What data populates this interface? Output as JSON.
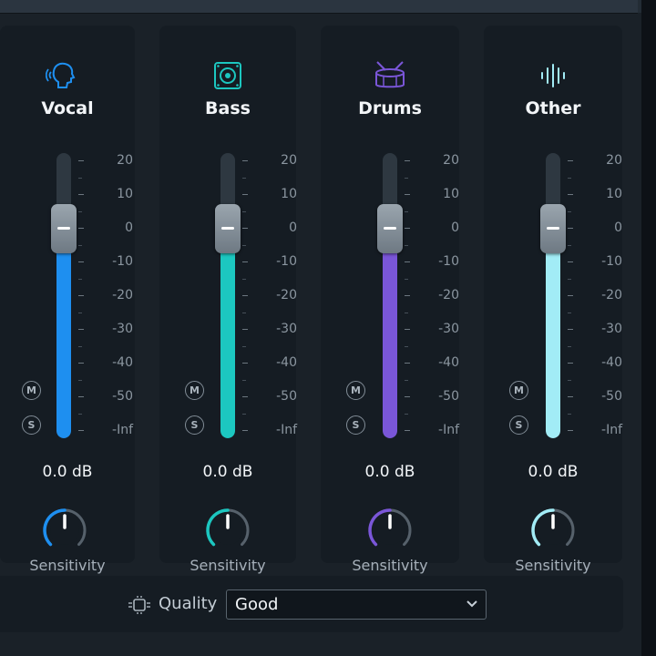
{
  "strips": [
    {
      "name": "Vocal",
      "icon": "vocal-head-icon",
      "color": "#1e8ff0",
      "db": "0.0 dB",
      "level_db": 0,
      "sensitivity_label": "Sensitivity",
      "sensitivity_fraction": 0.5,
      "mute_label": "M",
      "solo_label": "S"
    },
    {
      "name": "Bass",
      "icon": "speaker-icon",
      "color": "#1cc7c0",
      "db": "0.0 dB",
      "level_db": 0,
      "sensitivity_label": "Sensitivity",
      "sensitivity_fraction": 0.5,
      "mute_label": "M",
      "solo_label": "S"
    },
    {
      "name": "Drums",
      "icon": "drum-icon",
      "color": "#7a56d8",
      "db": "0.0 dB",
      "level_db": 0,
      "sensitivity_label": "Sensitivity",
      "sensitivity_fraction": 0.5,
      "mute_label": "M",
      "solo_label": "S"
    },
    {
      "name": "Other",
      "icon": "waveform-icon",
      "color": "#a2ecf6",
      "db": "0.0 dB",
      "level_db": 0,
      "sensitivity_label": "Sensitivity",
      "sensitivity_fraction": 0.5,
      "mute_label": "M",
      "solo_label": "S"
    }
  ],
  "scale_labels": [
    "20",
    "10",
    "0",
    "-10",
    "-20",
    "-30",
    "-40",
    "-50",
    "-Inf"
  ],
  "quality": {
    "label": "Quality",
    "value": "Good",
    "icon": "chip-icon"
  }
}
